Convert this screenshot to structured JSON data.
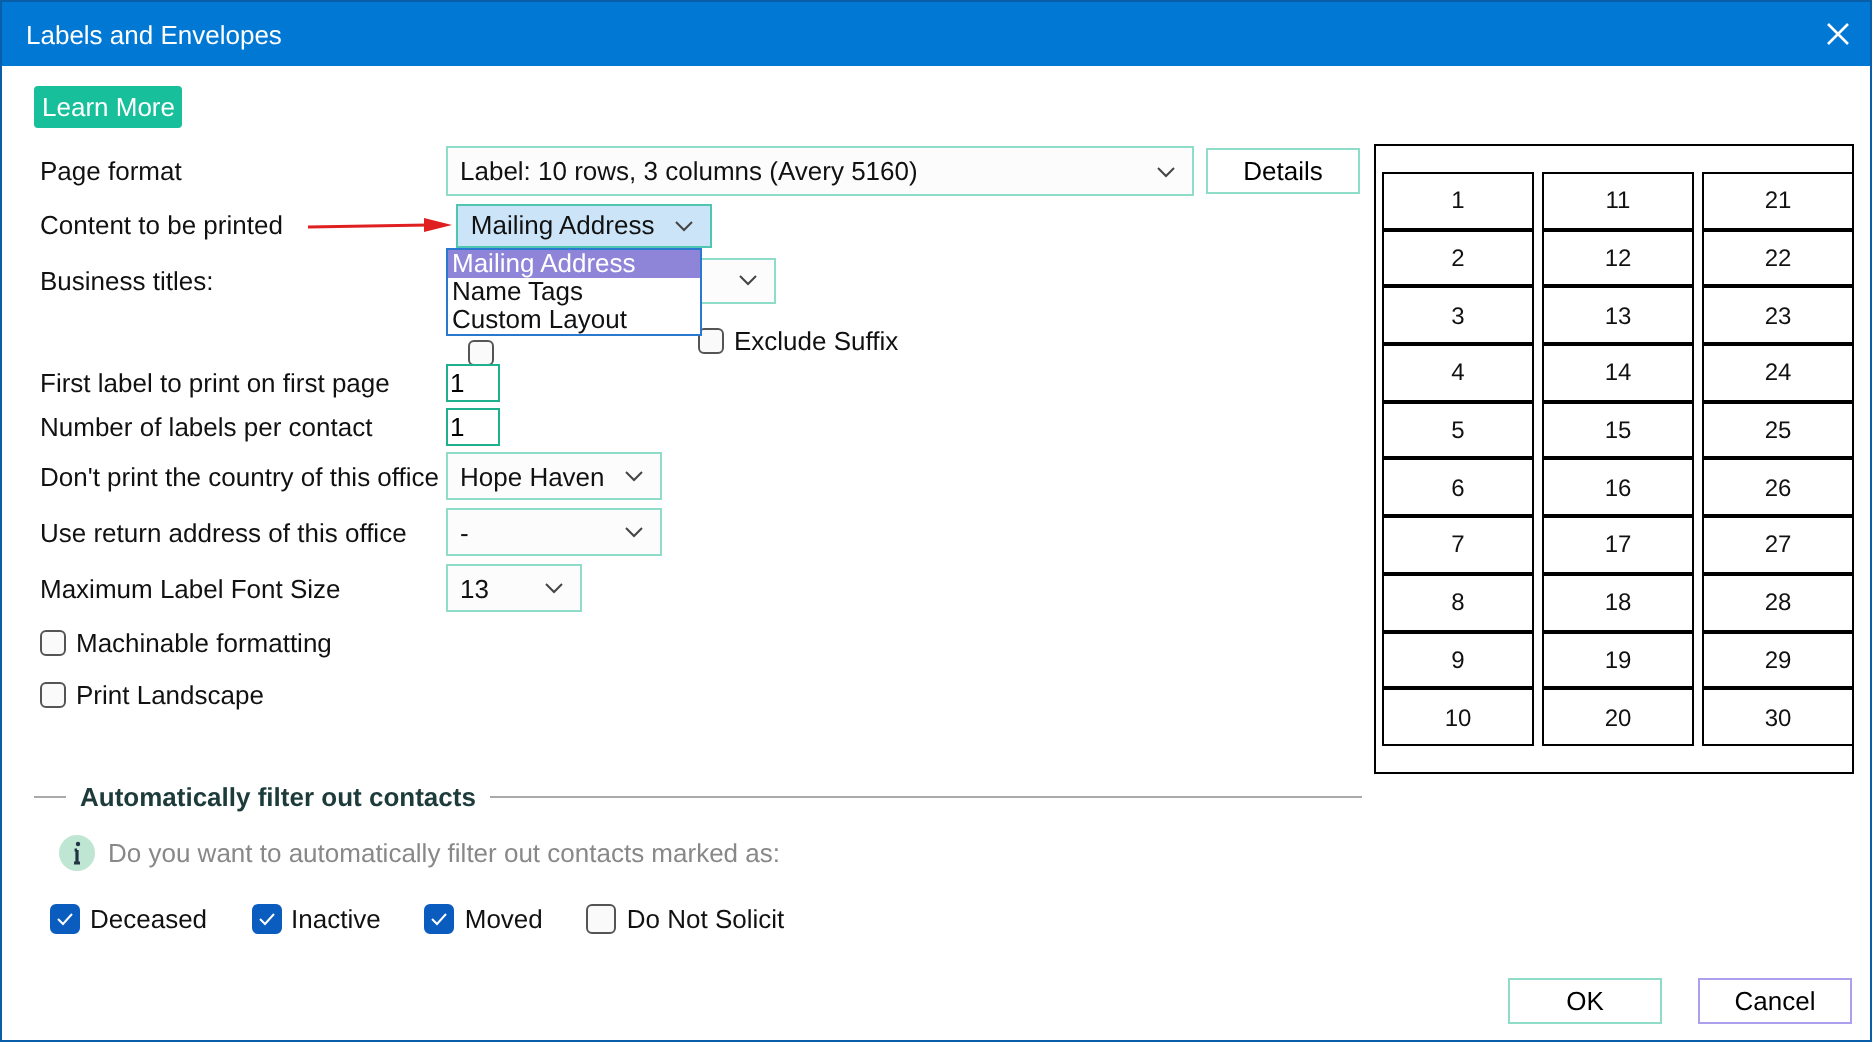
{
  "window": {
    "title": "Labels and Envelopes"
  },
  "learn_more": "Learn More",
  "page_format": {
    "label": "Page format",
    "value": "Label: 10 rows, 3 columns (Avery 5160)",
    "details": "Details"
  },
  "content": {
    "label": "Content to be printed",
    "value": "Mailing Address",
    "expanded": true,
    "options": [
      {
        "label": "Mailing Address",
        "selected": true
      },
      {
        "label": "Name Tags",
        "selected": false
      },
      {
        "label": "Custom Layout",
        "selected": false
      }
    ]
  },
  "business_titles": {
    "label": "Business titles:"
  },
  "exclude_prefix": {
    "checked": false
  },
  "exclude_suffix": {
    "label": "Exclude Suffix",
    "checked": false
  },
  "first_label": {
    "label": "First label to print on first page",
    "value": "1"
  },
  "labels_per_contact": {
    "label": "Number of labels per contact",
    "value": "1"
  },
  "country_office": {
    "label": "Don't print the country of this office",
    "value": "Hope Haven"
  },
  "return_office": {
    "label": "Use return address of this office",
    "value": "-"
  },
  "font_size": {
    "label": "Maximum Label Font Size",
    "value": "13"
  },
  "options": [
    {
      "label": "Machinable formatting",
      "checked": false
    },
    {
      "label": "Print Landscape",
      "checked": false
    }
  ],
  "preview": [
    "1",
    "2",
    "3",
    "4",
    "5",
    "6",
    "7",
    "8",
    "9",
    "10",
    "11",
    "12",
    "13",
    "14",
    "15",
    "16",
    "17",
    "18",
    "19",
    "20",
    "21",
    "22",
    "23",
    "24",
    "25",
    "26",
    "27",
    "28",
    "29",
    "30"
  ],
  "filter": {
    "title": "Automatically filter out contacts",
    "info": "Do you want to automatically filter out contacts marked as:",
    "items": [
      {
        "label": "Deceased",
        "checked": true
      },
      {
        "label": "Inactive",
        "checked": true
      },
      {
        "label": "Moved",
        "checked": true
      },
      {
        "label": "Do Not Solicit",
        "checked": false
      }
    ]
  },
  "buttons": [
    {
      "label": "OK",
      "kind": "primary"
    },
    {
      "label": "Cancel",
      "kind": "secondary"
    }
  ]
}
